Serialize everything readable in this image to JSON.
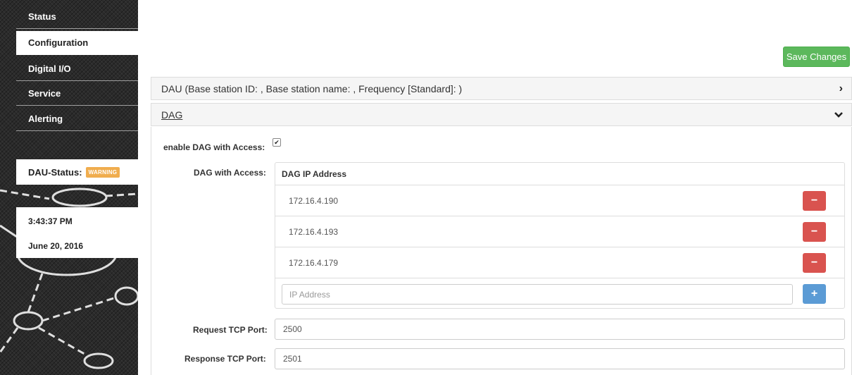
{
  "sidebar": {
    "items": [
      {
        "label": "Status"
      },
      {
        "label": "Configuration",
        "active": true
      },
      {
        "label": "Digital I/O"
      },
      {
        "label": "Service"
      },
      {
        "label": "Alerting"
      }
    ],
    "dau_status_label": "DAU-Status:",
    "dau_status_badge": "WARNING",
    "time": "3:43:37 PM",
    "date": "June 20, 2016"
  },
  "toolbar": {
    "save_label": "Save Changes"
  },
  "panels": {
    "dau": {
      "title": "DAU (Base station ID: , Base station name: , Frequency [Standard]: )",
      "chevron": "›"
    },
    "dag": {
      "title": "DAG",
      "chevron": "⌄"
    }
  },
  "dag_form": {
    "enable_label": "enable DAG with Access:",
    "enable_checked": true,
    "access_label": "DAG with Access:",
    "table_header": "DAG IP Address",
    "ips": [
      "172.16.4.190",
      "172.16.4.193",
      "172.16.4.179"
    ],
    "ip_placeholder": "IP Address",
    "request_port_label": "Request TCP Port:",
    "request_port_value": "2500",
    "response_port_label": "Response TCP Port:",
    "response_port_value": "2501"
  },
  "colors": {
    "save_green": "#5cb85c",
    "remove_red": "#d9534f",
    "add_blue": "#5b9bd5",
    "warning_orange": "#f0ad4e"
  },
  "icons": {
    "remove": "minus-icon",
    "add": "plus-icon",
    "dau_chevron": "chevron-right-icon",
    "dag_chevron": "chevron-down-icon"
  }
}
